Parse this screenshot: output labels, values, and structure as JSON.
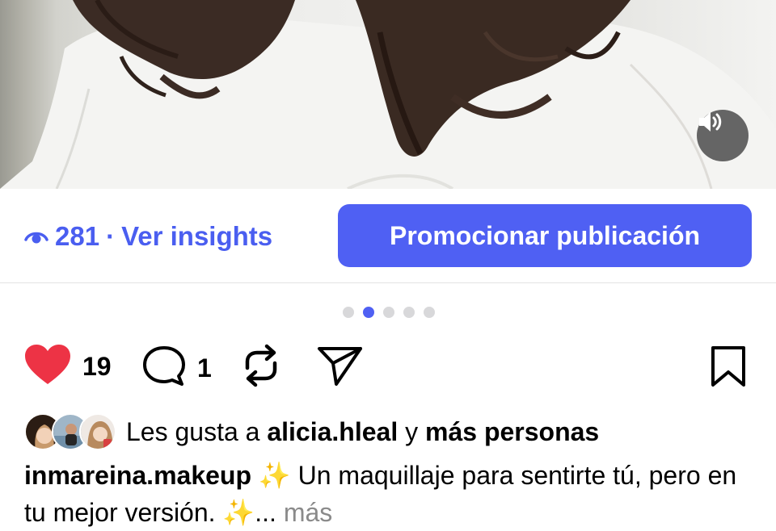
{
  "media": {
    "volume_icon": "speaker-icon"
  },
  "insights": {
    "eye_icon": "eye-icon",
    "views": "281",
    "separator": "·",
    "link_label": "Ver insights",
    "color": "#4a5ef0"
  },
  "promote": {
    "label": "Promocionar publicación",
    "color": "#4f60f3"
  },
  "carousel": {
    "total": 5,
    "active_index": 1
  },
  "actions": {
    "like_icon": "heart-icon",
    "likes": "19",
    "comment_icon": "comment-icon",
    "comments": "1",
    "repost_icon": "repost-icon",
    "share_icon": "send-icon",
    "save_icon": "bookmark-icon",
    "like_color": "#ed3345"
  },
  "liked_by": {
    "prefix": "Les gusta a",
    "user": "alicia.hleal",
    "connector": "y",
    "others": "más personas"
  },
  "caption": {
    "username": "inmareina.makeup",
    "sparkle": "✨",
    "text": "Un maquillaje para sentirte tú, pero en tu mejor versión.",
    "ellipsis": "...",
    "more": "más"
  }
}
